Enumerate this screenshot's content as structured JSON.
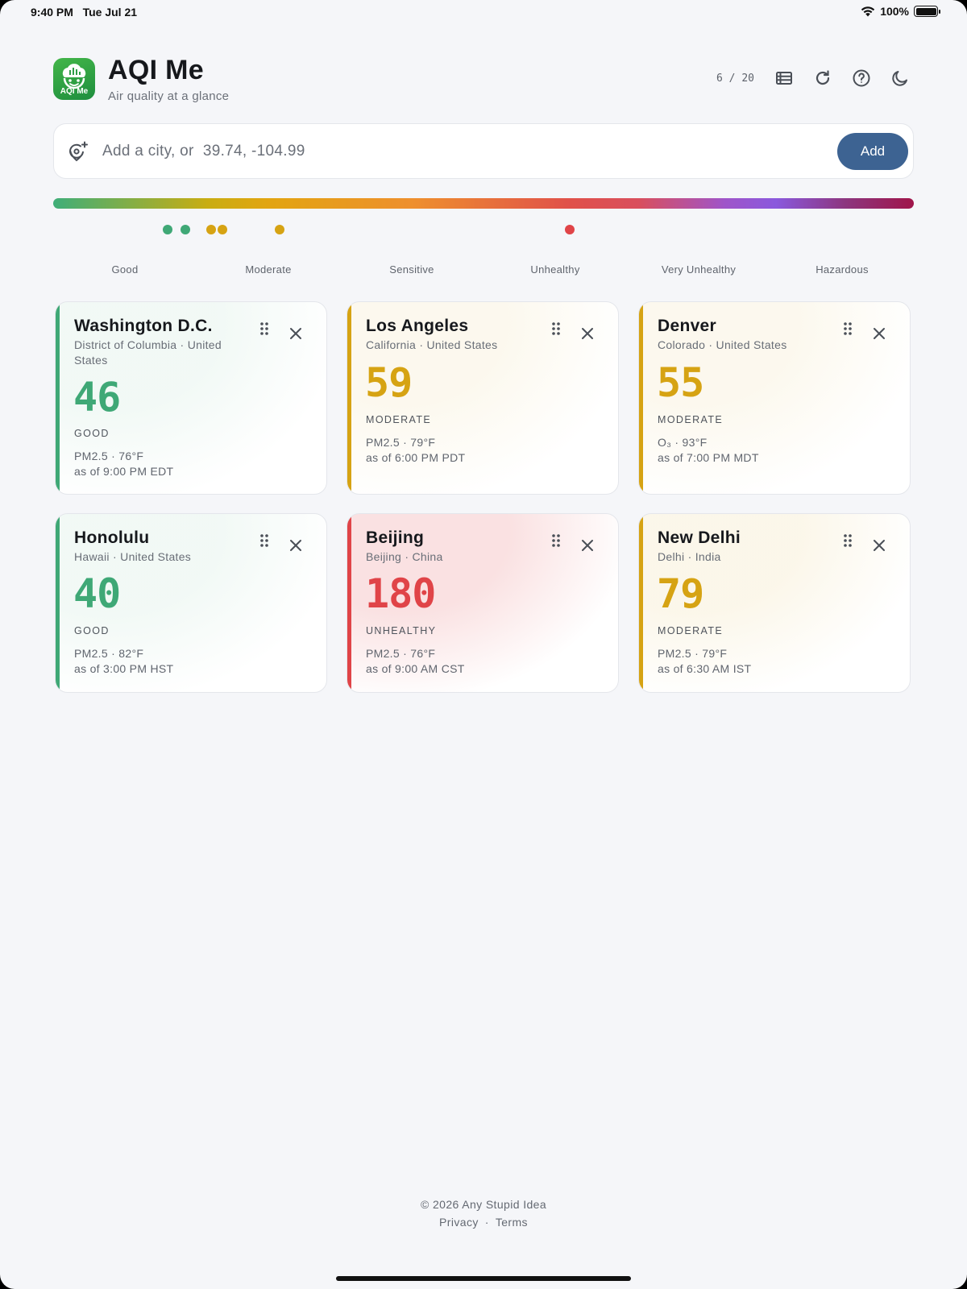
{
  "status_bar": {
    "time": "9:40 PM",
    "date": "Tue Jul 21",
    "battery": "100%"
  },
  "header": {
    "logo_text": "AQI Me",
    "title": "AQI Me",
    "subtitle": "Air quality at a glance",
    "city_count": "6 / 20",
    "icons": [
      "list-view-icon",
      "refresh-icon",
      "help-icon",
      "moon-icon"
    ]
  },
  "search": {
    "placeholder": "Add a city, or  39.74, -104.99",
    "value": "",
    "add_label": "Add"
  },
  "scale": {
    "labels": [
      "Good",
      "Moderate",
      "Sensitive",
      "Unhealthy",
      "Very Unhealthy",
      "Hazardous"
    ],
    "markers": [
      {
        "city": "Honolulu",
        "aqi": 40,
        "color": "#3fa876"
      },
      {
        "city": "Washington D.C.",
        "aqi": 46,
        "color": "#3fa876"
      },
      {
        "city": "Denver",
        "aqi": 55,
        "color": "#d6a313"
      },
      {
        "city": "Los Angeles",
        "aqi": 59,
        "color": "#d6a313"
      },
      {
        "city": "New Delhi",
        "aqi": 79,
        "color": "#d6a313"
      },
      {
        "city": "Beijing",
        "aqi": 180,
        "color": "#e04448"
      }
    ]
  },
  "cards": [
    {
      "city": "Washington D.C.",
      "region": "District of Columbia · United States",
      "aqi": "46",
      "category": "GOOD",
      "pollutant": "PM2.5 · 76°F",
      "time": "as of 9:00 PM EDT",
      "color": "#3fa876",
      "tint": "rgba(63,168,118,0.07)"
    },
    {
      "city": "Los Angeles",
      "region": "California · United States",
      "aqi": "59",
      "category": "MODERATE",
      "pollutant": "PM2.5 · 79°F",
      "time": "as of 6:00 PM PDT",
      "color": "#d6a313",
      "tint": "rgba(214,163,19,0.07)"
    },
    {
      "city": "Denver",
      "region": "Colorado · United States",
      "aqi": "55",
      "category": "MODERATE",
      "pollutant": "O₃ · 93°F",
      "time": "as of 7:00 PM MDT",
      "color": "#d6a313",
      "tint": "rgba(214,163,19,0.07)"
    },
    {
      "city": "Honolulu",
      "region": "Hawaii · United States",
      "aqi": "40",
      "category": "GOOD",
      "pollutant": "PM2.5 · 82°F",
      "time": "as of 3:00 PM HST",
      "color": "#3fa876",
      "tint": "rgba(63,168,118,0.07)"
    },
    {
      "city": "Beijing",
      "region": "Beijing · China",
      "aqi": "180",
      "category": "UNHEALTHY",
      "pollutant": "PM2.5 · 76°F",
      "time": "as of 9:00 AM CST",
      "color": "#e04448",
      "tint": "rgba(224,68,72,0.16)"
    },
    {
      "city": "New Delhi",
      "region": "Delhi · India",
      "aqi": "79",
      "category": "MODERATE",
      "pollutant": "PM2.5 · 79°F",
      "time": "as of 6:30 AM IST",
      "color": "#d6a313",
      "tint": "rgba(214,163,19,0.09)"
    }
  ],
  "footer": {
    "copyright": "© 2026 Any Stupid Idea",
    "privacy": "Privacy",
    "separator": "·",
    "terms": "Terms"
  }
}
